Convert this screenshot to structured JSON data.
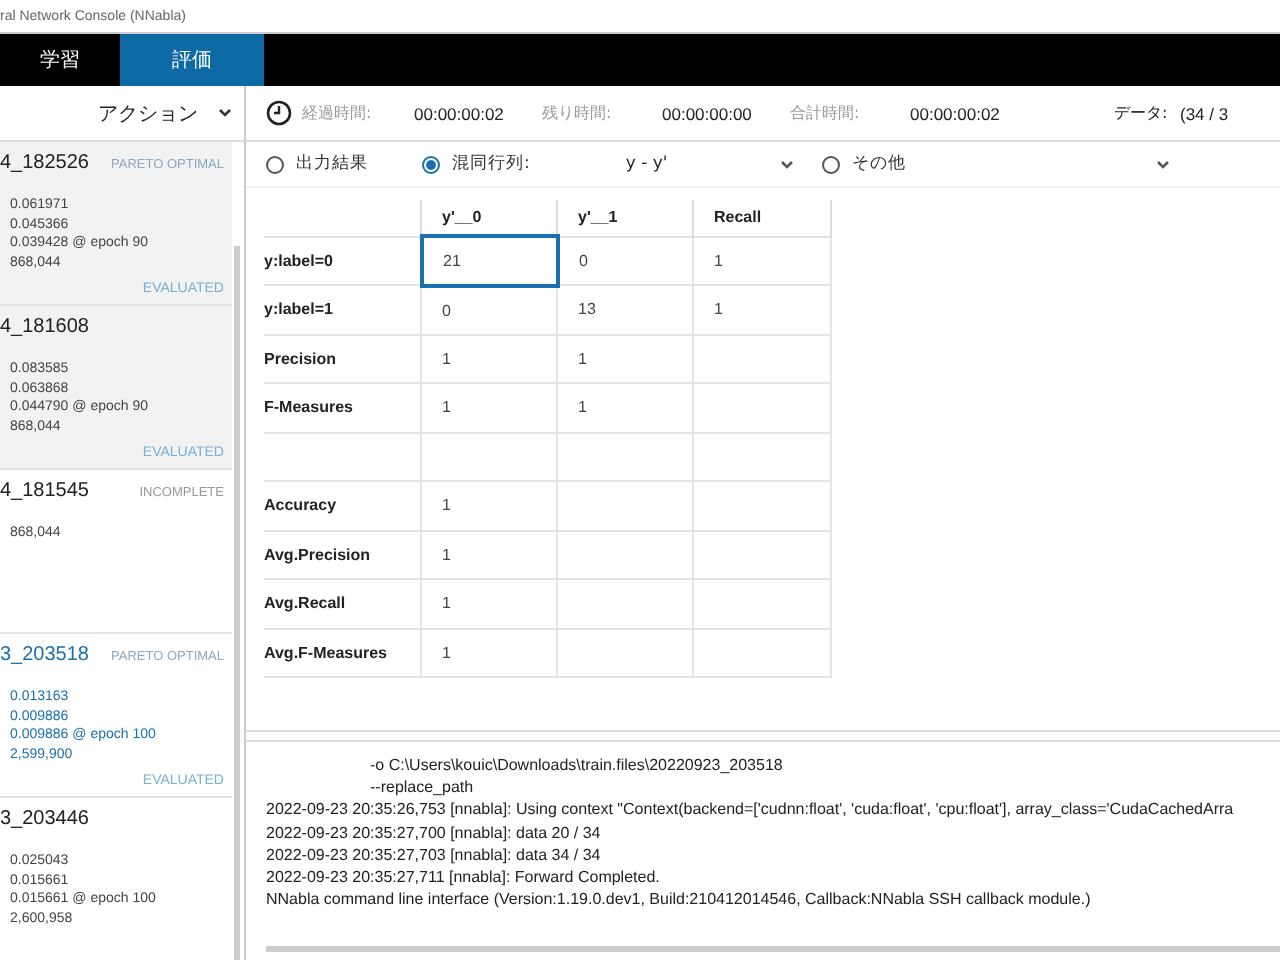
{
  "window": {
    "title": "ral Network Console (NNabla)"
  },
  "tabs": [
    {
      "label": "学習",
      "selected": false
    },
    {
      "label": "評価",
      "selected": true
    }
  ],
  "sidebar": {
    "action_label": "アクション",
    "items": [
      {
        "name": "4_182526",
        "tag": "PARETO OPTIMAL",
        "metrics": [
          "0.061971",
          "0.045366",
          "0.039428 @ epoch 90",
          "868,044"
        ],
        "footer": "EVALUATED",
        "selected": false
      },
      {
        "name": "4_181608",
        "metrics": [
          "0.083585",
          "0.063868",
          "0.044790 @ epoch 90",
          "868,044"
        ],
        "footer": "EVALUATED",
        "selected": false
      },
      {
        "name": "4_181545",
        "tag": "INCOMPLETE",
        "metrics": [
          "868,044"
        ],
        "selected": false
      },
      {
        "name": "3_203518",
        "tag": "PARETO OPTIMAL",
        "metrics": [
          "0.013163",
          "0.009886",
          "0.009886 @ epoch 100",
          "2,599,900"
        ],
        "footer": "EVALUATED",
        "selected": true
      },
      {
        "name": "3_203446",
        "metrics": [
          "0.025043",
          "0.015661",
          "0.015661 @ epoch 100",
          "2,600,958"
        ],
        "selected": false
      }
    ]
  },
  "status": {
    "elapsed_label": "経過時間:",
    "elapsed": "00:00:00:02",
    "remaining_label": "残り時間:",
    "remaining": "00:00:00:00",
    "total_label": "合計時間:",
    "total": "00:00:00:02",
    "data_label": "データ:",
    "data": "(34 / 3"
  },
  "options": [
    {
      "label": "出力結果",
      "selected": false,
      "kind": "plain"
    },
    {
      "label": "混同行列:",
      "selected": true,
      "kind": "dropdown",
      "value": "y - y'"
    },
    {
      "label": "その他",
      "selected": false,
      "kind": "dropdown"
    }
  ],
  "table": {
    "columns": [
      "y'__0",
      "y'__1",
      "Recall"
    ],
    "rows": [
      {
        "kind": "data",
        "label": "y:label=0",
        "cells": [
          {
            "text": "21",
            "selected": true
          },
          {
            "text": "0",
            "selected": false
          },
          {
            "text": "1",
            "selected": false
          }
        ]
      },
      {
        "kind": "data",
        "label": "y:label=1",
        "cells": [
          {
            "text": "0",
            "selected": false
          },
          {
            "text": "13",
            "selected": false
          },
          {
            "text": "1",
            "selected": false
          }
        ]
      },
      {
        "kind": "data",
        "label": "Precision",
        "cells": [
          {
            "text": "1",
            "selected": false
          },
          {
            "text": "1",
            "selected": false
          }
        ]
      },
      {
        "kind": "data",
        "label": "F-Measures",
        "cells": [
          {
            "text": "1",
            "selected": false
          },
          {
            "text": "1",
            "selected": false
          }
        ]
      },
      {
        "kind": "blank"
      },
      {
        "kind": "data",
        "label": "Accuracy",
        "cells": [
          {
            "text": "1",
            "selected": false
          }
        ]
      },
      {
        "kind": "data",
        "label": "Avg.Precision",
        "cells": [
          {
            "text": "1",
            "selected": false
          }
        ]
      },
      {
        "kind": "data",
        "label": "Avg.Recall",
        "cells": [
          {
            "text": "1",
            "selected": false
          }
        ]
      },
      {
        "kind": "data",
        "label": "Avg.F-Measures",
        "cells": [
          {
            "text": "1",
            "selected": false
          }
        ]
      }
    ]
  },
  "log": {
    "lines": [
      "-o  C:\\Users\\kouic\\Downloads\\train.files\\20220923_203518",
      "--replace_path",
      "2022-09-23 20:35:26,753 [nnabla]: Using context \"Context(backend=['cudnn:float', 'cuda:float', 'cpu:float'], array_class='CudaCachedArra",
      "2022-09-23 20:35:27,700 [nnabla]: data 20 / 34",
      "2022-09-23 20:35:27,703 [nnabla]: data 34 / 34",
      "2022-09-23 20:35:27,711 [nnabla]: Forward Completed.",
      "NNabla command line interface (Version:1.19.0.dev1, Build:210412014546, Callback:NNabla SSH callback module.)"
    ]
  }
}
